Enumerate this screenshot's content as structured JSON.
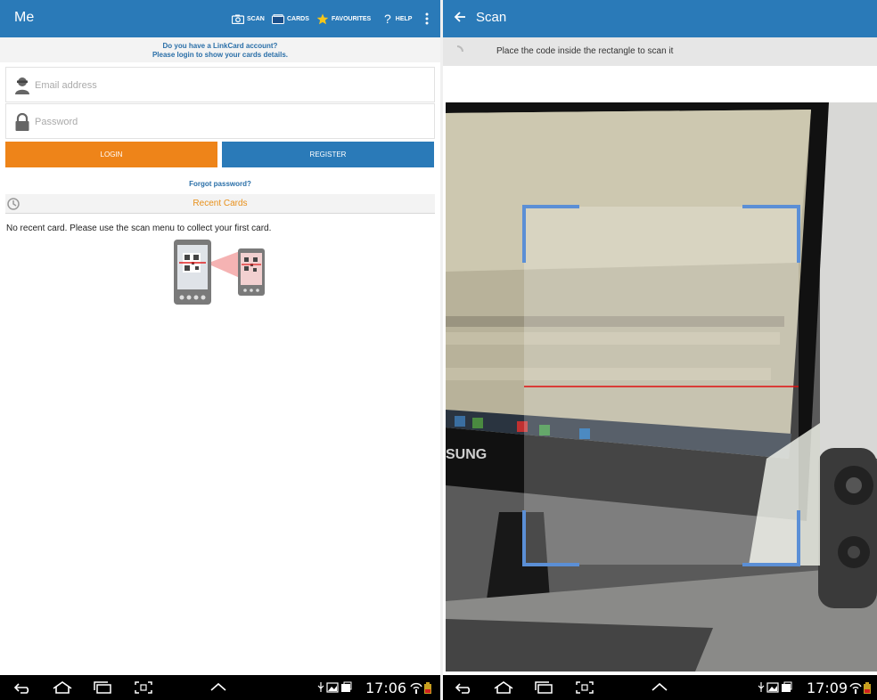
{
  "left": {
    "app_bar": {
      "title": "Me",
      "actions": [
        {
          "label": "SCAN",
          "icon": "camera-icon"
        },
        {
          "label": "CARDS",
          "icon": "cards-icon"
        },
        {
          "label": "FAVOURITES",
          "icon": "star-icon"
        },
        {
          "label": "HELP",
          "icon": "question-icon"
        }
      ],
      "overflow_icon": "more-vert-icon"
    },
    "notice": {
      "line1": "Do you have a LinkCard account?",
      "line2": "Please login to show your cards details."
    },
    "email": {
      "placeholder": "Email address",
      "value": "",
      "icon": "user-icon"
    },
    "password": {
      "placeholder": "Password",
      "value": "",
      "icon": "lock-icon"
    },
    "login_label": "LOGIN",
    "register_label": "REGISTER",
    "forgot_label": "Forgot password?",
    "recent": {
      "title": "Recent Cards",
      "icon": "clock-icon"
    },
    "no_recent_text": "No recent card. Please use the scan menu to collect your first card.",
    "nav": {
      "time": "17:06"
    }
  },
  "right": {
    "app_bar": {
      "title": "Scan",
      "back_icon": "arrow-back-icon"
    },
    "hint": "Place the code inside the rectangle to scan it",
    "camera_logo_text": "SUNG",
    "nav": {
      "time": "17:09"
    }
  },
  "colors": {
    "app_bar": "#2a7ab8",
    "login": "#ee8419",
    "register": "#2a7ab8",
    "link": "#2a6fa8",
    "recent_title": "#e8901a",
    "scan_frame": "#5b8fd6",
    "scan_line": "#e01010"
  }
}
